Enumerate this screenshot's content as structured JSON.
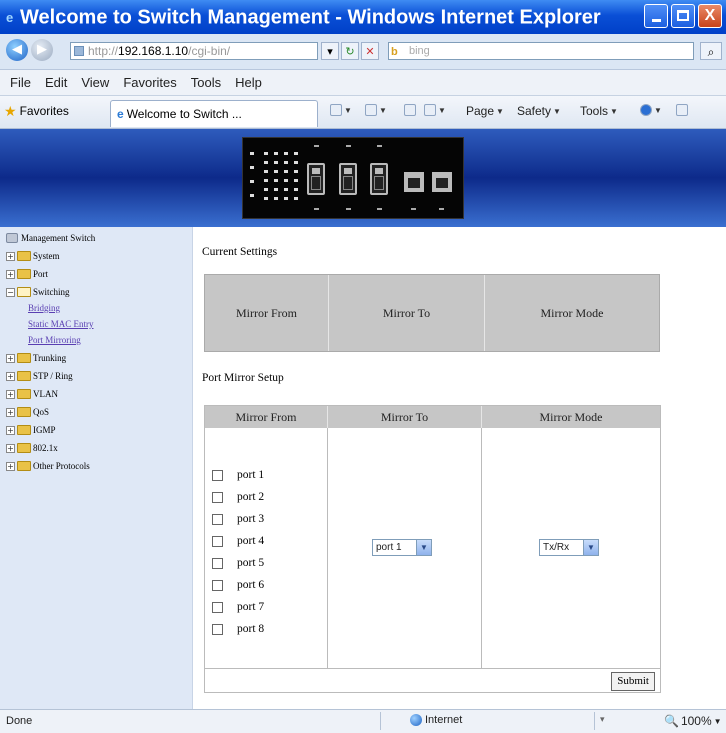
{
  "window": {
    "title": "Welcome to Switch Management - Windows Internet Explorer",
    "minimize_icon": "minimize-icon",
    "maximize_icon": "maximize-icon",
    "close_label": "X"
  },
  "addressbar": {
    "url_prefix": "http://",
    "url_host": "192.168.1.10",
    "url_rest": "/cgi-bin/",
    "search_engine": "bing",
    "search_placeholder": "bing"
  },
  "menu": {
    "items": [
      "File",
      "Edit",
      "View",
      "Favorites",
      "Tools",
      "Help"
    ]
  },
  "favbar": {
    "favorites_label": "Favorites",
    "tab_title": "Welcome to Switch ...",
    "page_label": "Page",
    "safety_label": "Safety",
    "tools_label": "Tools"
  },
  "sidebar": {
    "root": "Management Switch",
    "items": [
      {
        "label": "System",
        "sign": "+"
      },
      {
        "label": "Port",
        "sign": "+"
      },
      {
        "label": "Switching",
        "sign": "−"
      },
      {
        "label": "Trunking",
        "sign": "+"
      },
      {
        "label": "STP / Ring",
        "sign": "+"
      },
      {
        "label": "VLAN",
        "sign": "+"
      },
      {
        "label": "QoS",
        "sign": "+"
      },
      {
        "label": "IGMP",
        "sign": "+"
      },
      {
        "label": "802.1x",
        "sign": "+"
      },
      {
        "label": "Other Protocols",
        "sign": "+"
      }
    ],
    "switching_children": [
      "Bridging",
      "Static MAC Entry",
      "Port Mirroring"
    ]
  },
  "current": {
    "heading": "Current Settings",
    "headers": [
      "Mirror From",
      "Mirror To",
      "Mirror Mode"
    ]
  },
  "setup": {
    "heading": "Port Mirror Setup",
    "headers": [
      "Mirror From",
      "Mirror To",
      "Mirror Mode"
    ],
    "ports": [
      "port 1",
      "port 2",
      "port 3",
      "port 4",
      "port 5",
      "port 6",
      "port 7",
      "port 8"
    ],
    "mirror_to_value": "port 1",
    "mirror_mode_value": "Tx/Rx",
    "submit_label": "Submit"
  },
  "status": {
    "text": "Done",
    "zone": "Internet",
    "zoom": "100%"
  },
  "colors": {
    "titlebar": "#0a4fd6",
    "banner": "#0d2a8a",
    "sidebar": "#dfe8f6",
    "table_header": "#c6c6c6",
    "link": "#5a3fb2"
  }
}
